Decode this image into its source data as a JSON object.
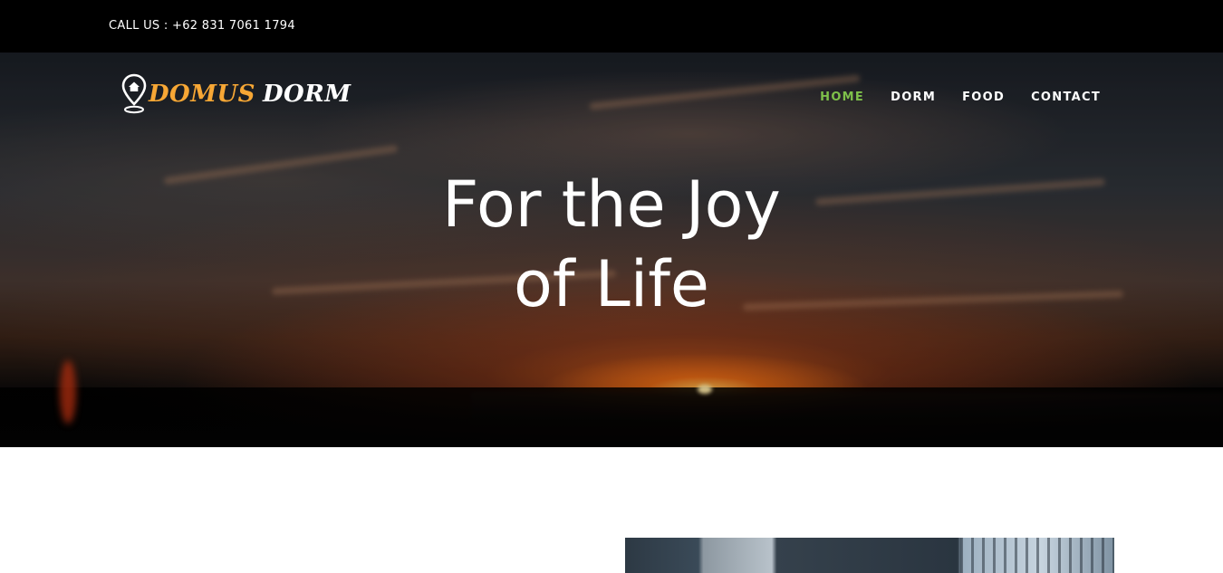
{
  "topbar": {
    "call_text": "CALL US : +62 831 7061 1794"
  },
  "brand": {
    "word1": "DOMUS",
    "word2": "DORM",
    "icon": "map-pin-home-icon",
    "accent_color": "#f7a735"
  },
  "nav": {
    "items": [
      {
        "label": "HOME",
        "active": true
      },
      {
        "label": "DORM",
        "active": false
      },
      {
        "label": "FOOD",
        "active": false
      },
      {
        "label": "CONTACT",
        "active": false
      }
    ],
    "active_color": "#7ec04a"
  },
  "hero": {
    "line1": "For the Joy",
    "line2": "of Life"
  }
}
